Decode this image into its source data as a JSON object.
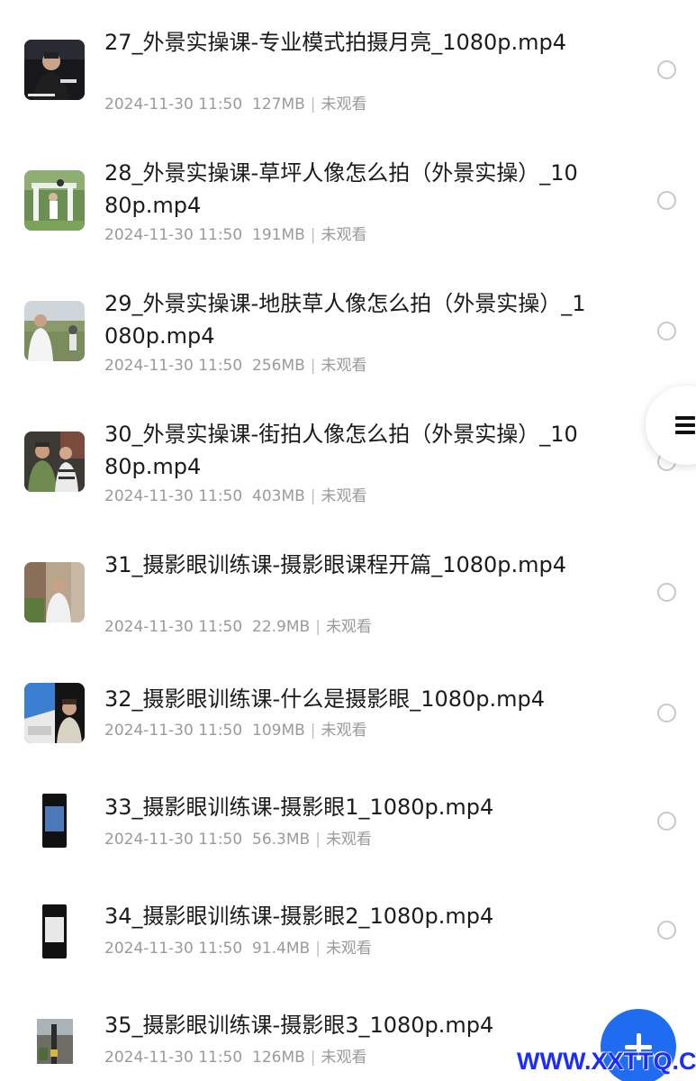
{
  "files": [
    {
      "title": "27_外景实操课-专业模式拍摄月亮_1080p.mp4",
      "date": "2024-11-30 11:50",
      "size": "127MB",
      "status": "未观看",
      "thumb": "night-person"
    },
    {
      "title": "28_外景实操课-草坪人像怎么拍（外景实操）_1080p.mp4",
      "date": "2024-11-30 11:50",
      "size": "191MB",
      "status": "未观看",
      "thumb": "lawn-portrait"
    },
    {
      "title": "29_外景实操课-地肤草人像怎么拍（外景实操）_1080p.mp4",
      "date": "2024-11-30 11:50",
      "size": "256MB",
      "status": "未观看",
      "thumb": "field-person"
    },
    {
      "title": "30_外景实操课-街拍人像怎么拍（外景实操）_1080p.mp4",
      "date": "2024-11-30 11:50",
      "size": "403MB",
      "status": "未观看",
      "thumb": "street-people"
    },
    {
      "title": "31_摄影眼训练课-摄影眼课程开篇_1080p.mp4",
      "date": "2024-11-30 11:50",
      "size": "22.9MB",
      "status": "未观看",
      "thumb": "outdoor-person"
    },
    {
      "title": "32_摄影眼训练课-什么是摄影眼_1080p.mp4",
      "date": "2024-11-30 11:50",
      "size": "109MB",
      "status": "未观看",
      "thumb": "sky-person"
    },
    {
      "title": "33_摄影眼训练课-摄影眼1_1080p.mp4",
      "date": "2024-11-30 11:50",
      "size": "56.3MB",
      "status": "未观看",
      "thumb": "phone-screen"
    },
    {
      "title": "34_摄影眼训练课-摄影眼2_1080p.mp4",
      "date": "2024-11-30 11:50",
      "size": "91.4MB",
      "status": "未观看",
      "thumb": "phone-screen"
    },
    {
      "title": "35_摄影眼训练课-摄影眼3_1080p.mp4",
      "date": "2024-11-30 11:50",
      "size": "126MB",
      "status": "未观看",
      "thumb": "street-pole"
    }
  ],
  "side_menu_icon": "menu-lines-icon",
  "fab_icon": "plus-icon",
  "watermark": "WWW.XXTTQ.COM",
  "colors": {
    "accent": "#1f6cf0",
    "title": "#1b1b1b",
    "meta": "#9a9a9a",
    "watermark": "#1a2cff"
  }
}
